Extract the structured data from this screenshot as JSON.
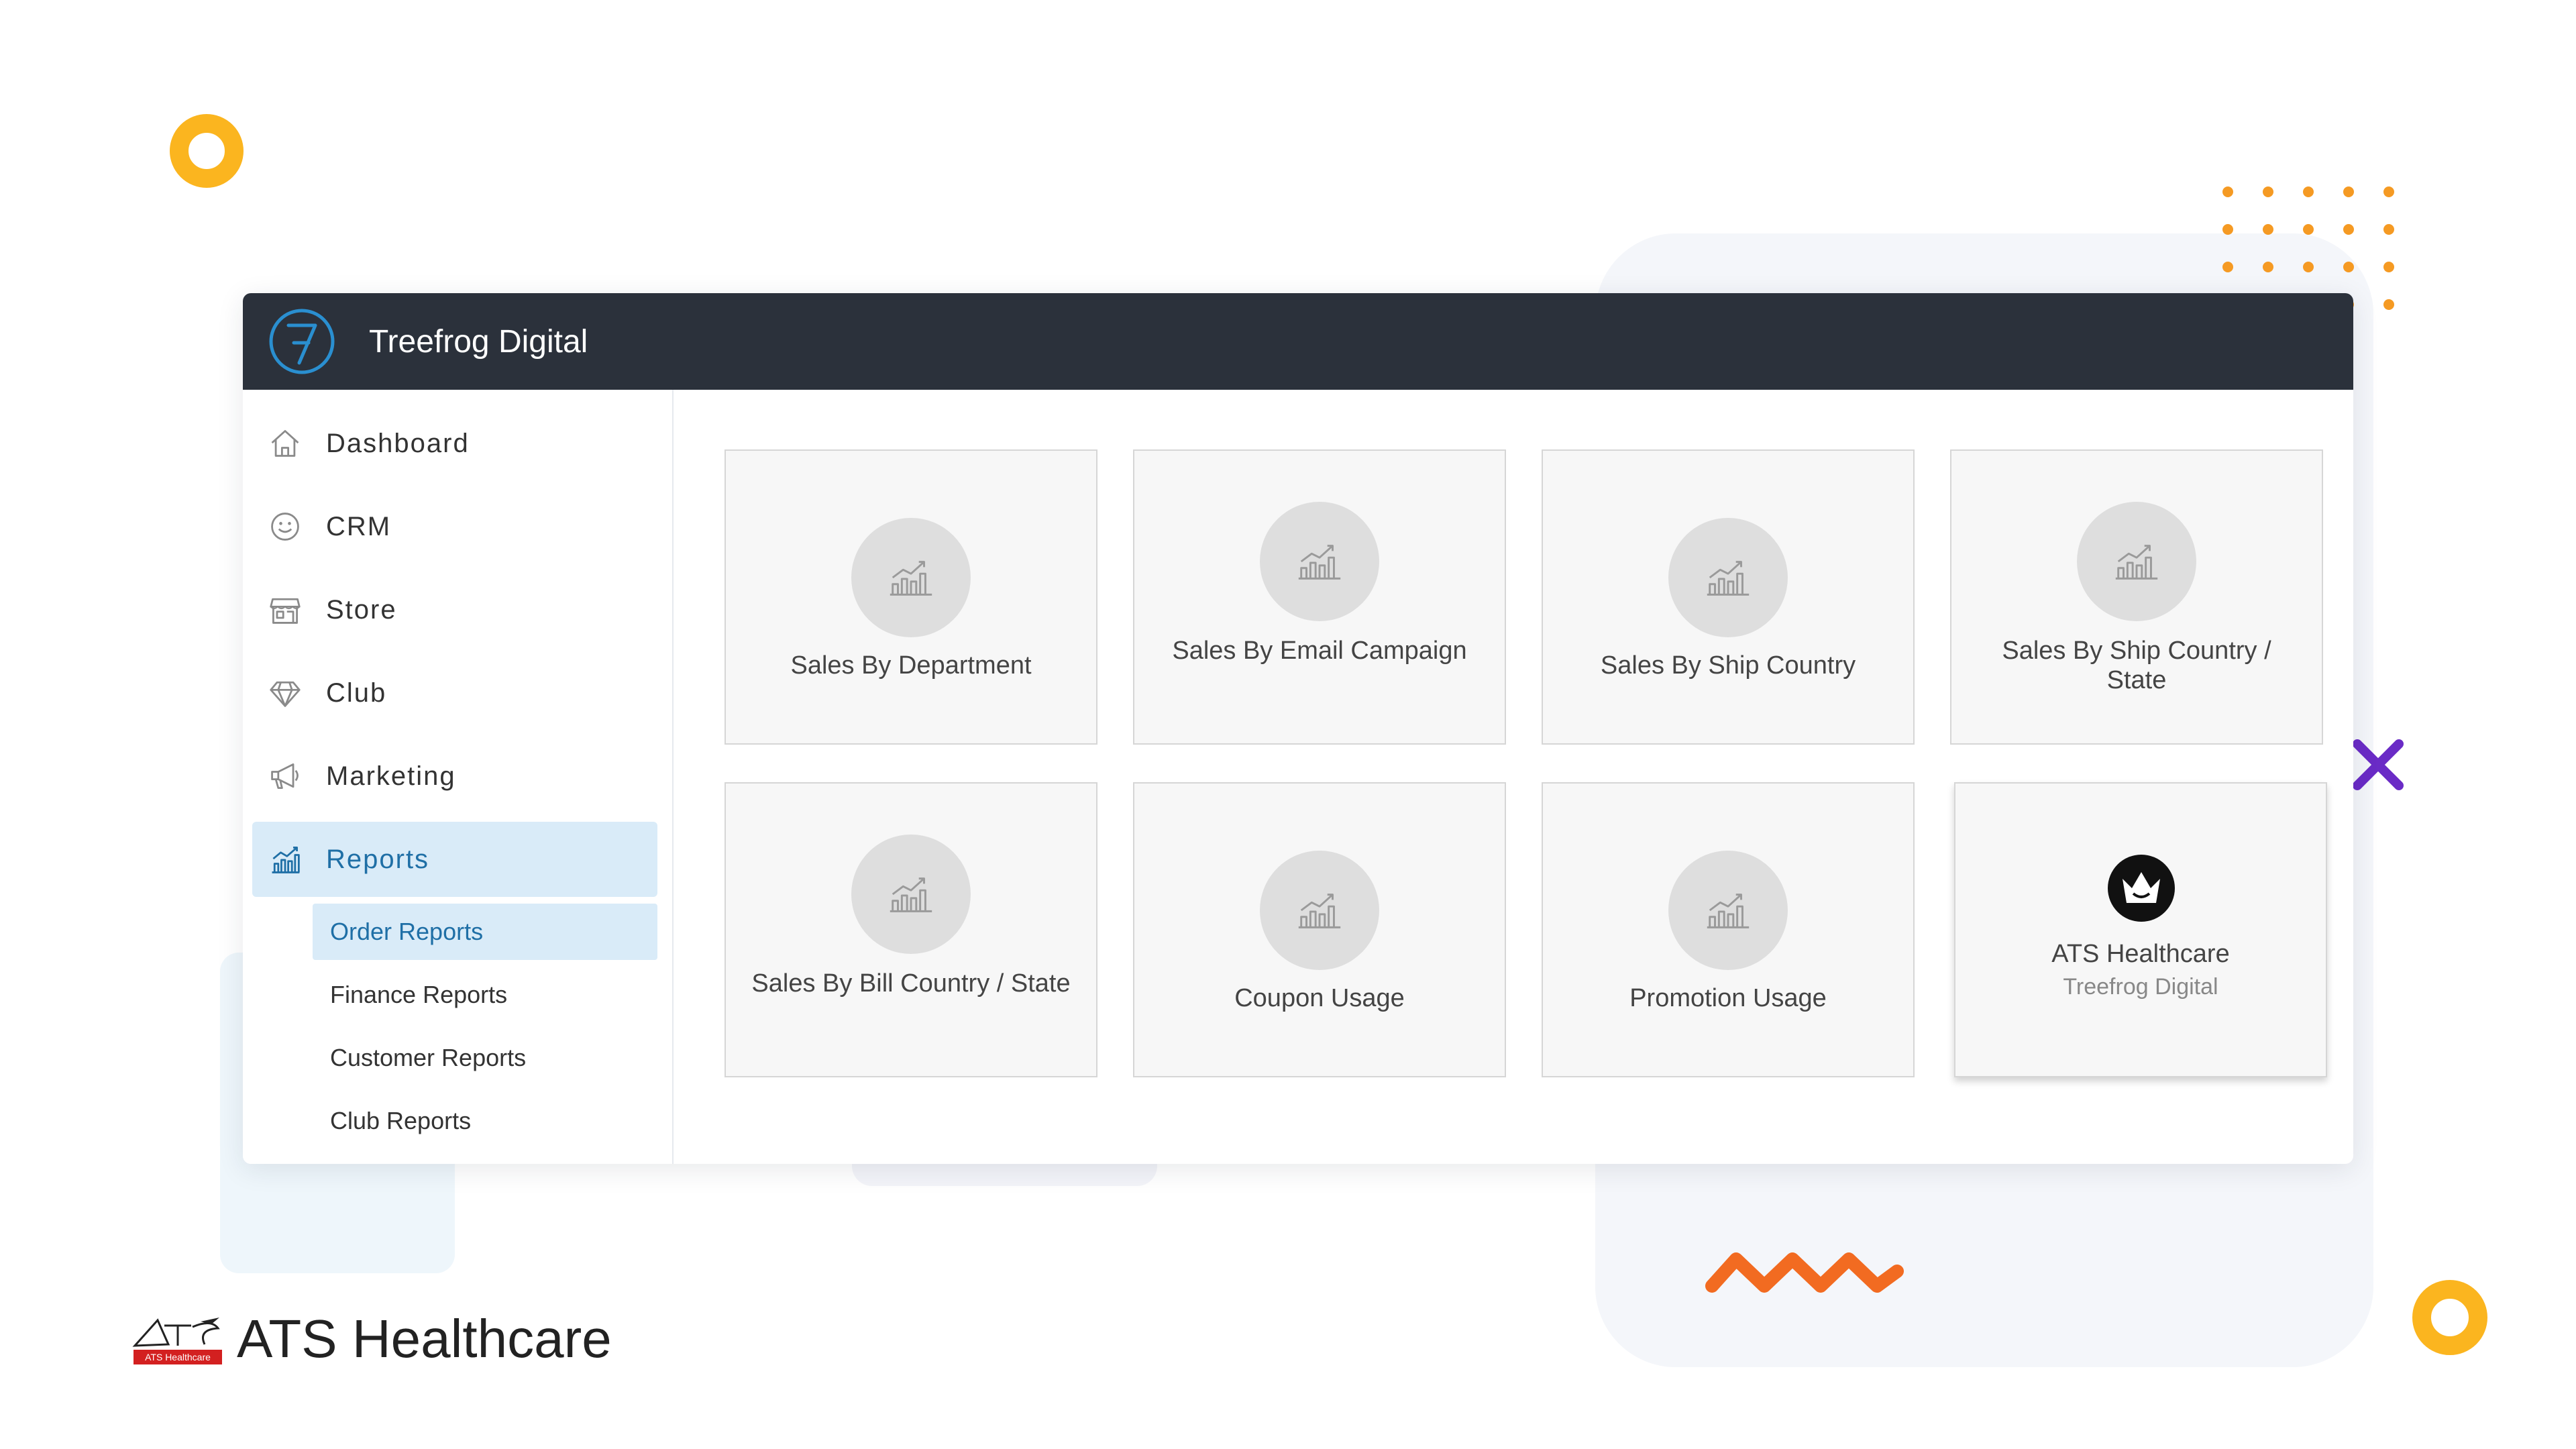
{
  "app": {
    "title": "Treefrog Digital",
    "logo_icon": "treefrog-7-logo-icon"
  },
  "sidebar": {
    "items": [
      {
        "label": "Dashboard",
        "icon": "home-icon"
      },
      {
        "label": "CRM",
        "icon": "smiley-icon"
      },
      {
        "label": "Store",
        "icon": "storefront-icon"
      },
      {
        "label": "Club",
        "icon": "diamond-icon"
      },
      {
        "label": "Marketing",
        "icon": "megaphone-icon"
      },
      {
        "label": "Reports",
        "icon": "bar-chart-icon",
        "active": true
      }
    ],
    "sub_items": [
      {
        "label": "Order Reports",
        "active": true
      },
      {
        "label": "Finance Reports"
      },
      {
        "label": "Customer Reports"
      },
      {
        "label": "Club Reports"
      }
    ]
  },
  "reports": {
    "cards": [
      {
        "label": "Sales By Department",
        "icon": "chart-growth-icon"
      },
      {
        "label": "Sales By Email Campaign",
        "icon": "chart-growth-icon"
      },
      {
        "label": "Sales By Ship Country",
        "icon": "chart-growth-icon"
      },
      {
        "label": "Sales By Ship Country / State",
        "icon": "chart-growth-icon"
      },
      {
        "label": "Sales By Bill Country / State",
        "icon": "chart-growth-icon"
      },
      {
        "label": "Coupon Usage",
        "icon": "chart-growth-icon"
      },
      {
        "label": "Promotion Usage",
        "icon": "chart-growth-icon"
      }
    ],
    "account_card": {
      "name": "ATS Healthcare",
      "sub": "Treefrog Digital",
      "icon": "crown-badge-icon"
    }
  },
  "brand": {
    "name": "ATS Healthcare",
    "logo_text": "ATS Healthcare"
  },
  "colors": {
    "titlebar": "#2b313b",
    "accent_blue": "#1f6fa6",
    "active_bg": "#d9ebf8",
    "ring_yellow": "#fbb51f",
    "dot_orange": "#f59a23",
    "x_purple": "#6a2bc6",
    "zigzag_orange": "#f26b21"
  }
}
